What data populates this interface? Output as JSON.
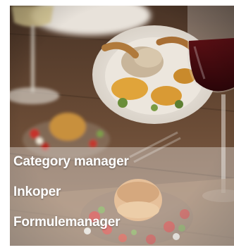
{
  "hero_image": {
    "subject": "restaurant table with plated dishes and red wine"
  },
  "menu": {
    "items": [
      {
        "label": "Category manager"
      },
      {
        "label": "Inkoper"
      },
      {
        "label": "Formulemanager"
      }
    ]
  }
}
